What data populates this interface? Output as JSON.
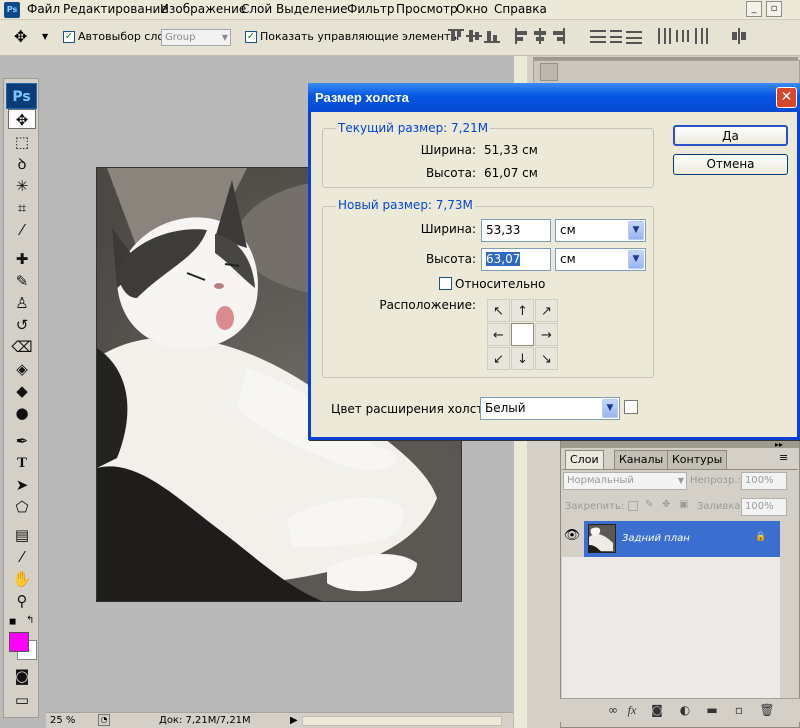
{
  "app": {
    "badge": "Ps"
  },
  "menu": [
    "Файл",
    "Редактирование",
    "Изображение",
    "Слой",
    "Выделение",
    "Фильтр",
    "Просмотр",
    "Окно",
    "Справка"
  ],
  "window_controls": {
    "minimize": "_",
    "restore": "▫"
  },
  "options_bar": {
    "auto_select_label": "Автовыбор слоя",
    "auto_select_value": "Group",
    "show_controls_label": "Показать управляющие элементы"
  },
  "toolbox": {
    "tools": [
      "move-tool",
      "marquee-tool",
      "lasso-tool",
      "magic-wand-tool",
      "crop-tool",
      "eyedropper-tool",
      "healing-brush-tool",
      "brush-tool",
      "clone-stamp-tool",
      "history-brush-tool",
      "eraser-tool",
      "paint-bucket-tool",
      "blur-tool",
      "dodge-tool",
      "pen-tool",
      "type-tool",
      "path-select-tool",
      "shape-tool",
      "notes-tool",
      "eyedropper-2-tool",
      "hand-tool",
      "zoom-tool"
    ],
    "foreground_color": "#ff00ff",
    "background_color": "#ffffff"
  },
  "status": {
    "zoom": "25 %",
    "doc_info": "Док: 7,21M/7,21M"
  },
  "dialog": {
    "title": "Размер холста",
    "current": {
      "legend": "Текущий размер: 7,21M",
      "width_label": "Ширина:",
      "width_value": "51,33 см",
      "height_label": "Высота:",
      "height_value": "61,07 см"
    },
    "new": {
      "legend": "Новый размер: 7,73M",
      "width_label": "Ширина:",
      "width_value": "53,33",
      "width_unit": "см",
      "height_label": "Высота:",
      "height_value": "63,07",
      "height_unit": "см",
      "relative_label": "Относительно",
      "anchor_label": "Расположение:"
    },
    "extension_color_label": "Цвет расширения холста:",
    "extension_color_value": "Белый",
    "ok_label": "Да",
    "cancel_label": "Отмена"
  },
  "layers_panel": {
    "tabs": [
      "Слои",
      "Каналы",
      "Контуры"
    ],
    "blend_mode": "Нормальный",
    "opacity_label": "Непрозр.:",
    "opacity_value": "100%",
    "lock_label": "Закрепить:",
    "fill_label": "Заливка:",
    "fill_value": "100%",
    "layer_name": "Задний план",
    "footer_icons": [
      "link-icon",
      "fx-icon",
      "mask-icon",
      "adjustment-icon",
      "folder-icon",
      "new-layer-icon",
      "trash-icon"
    ]
  },
  "colors": {
    "dialog_title": "#0556e3",
    "legend_text": "#0046d5",
    "selected_layer": "#3a6fd0",
    "canvas_bg": "#b9b9b9"
  }
}
